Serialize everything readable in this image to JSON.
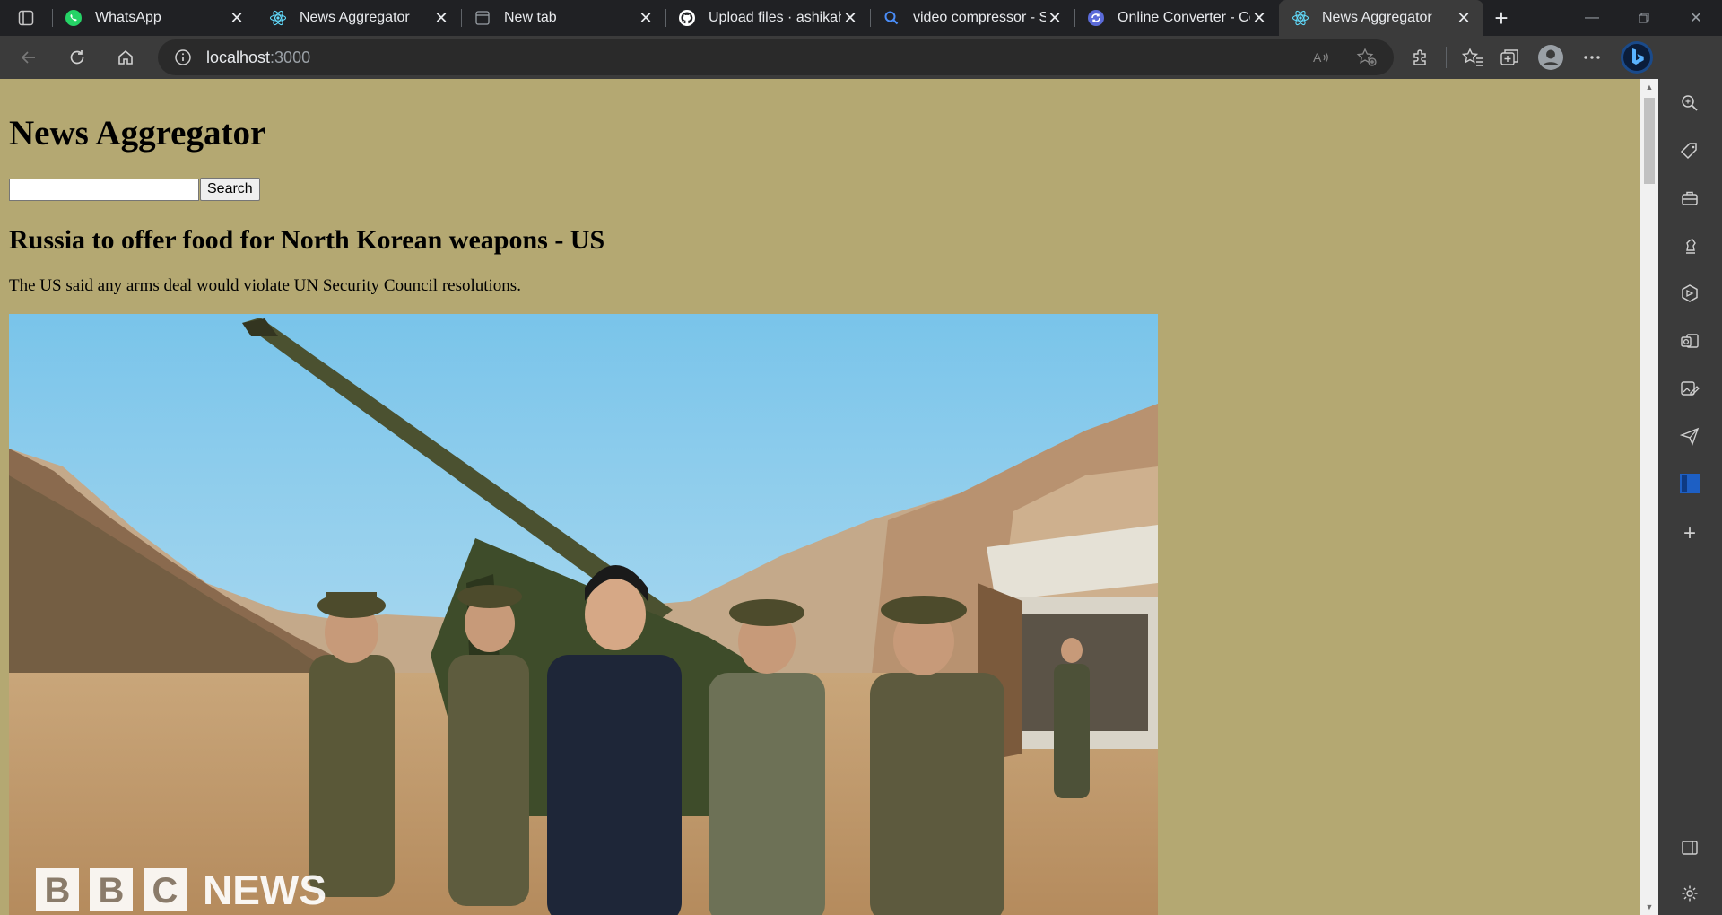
{
  "browser": {
    "tabs": [
      {
        "title": "WhatsApp",
        "icon": "whatsapp-icon",
        "active": false
      },
      {
        "title": "News Aggregator",
        "icon": "react-icon",
        "active": false
      },
      {
        "title": "New tab",
        "icon": "newtab-icon",
        "active": false
      },
      {
        "title": "Upload files · ashikahe",
        "icon": "github-icon",
        "active": false
      },
      {
        "title": "video compressor - Se",
        "icon": "search-icon",
        "active": false
      },
      {
        "title": "Online Converter - Co",
        "icon": "converter-icon",
        "active": false
      },
      {
        "title": "News Aggregator",
        "icon": "react-icon",
        "active": true
      }
    ],
    "address": {
      "host": "localhost",
      "port": ":3000"
    }
  },
  "page": {
    "heading": "News Aggregator",
    "search": {
      "value": "",
      "button_label": "Search"
    },
    "article": {
      "title": "Russia to offer food for North Korean weapons - US",
      "description": "The US said any arms deal would violate UN Security Council resolutions.",
      "image_watermark": "BBC NEWS"
    }
  },
  "colors": {
    "page_background": "#b4a872",
    "chrome_dark": "#202124",
    "chrome_toolbar": "#3b3b3b"
  }
}
